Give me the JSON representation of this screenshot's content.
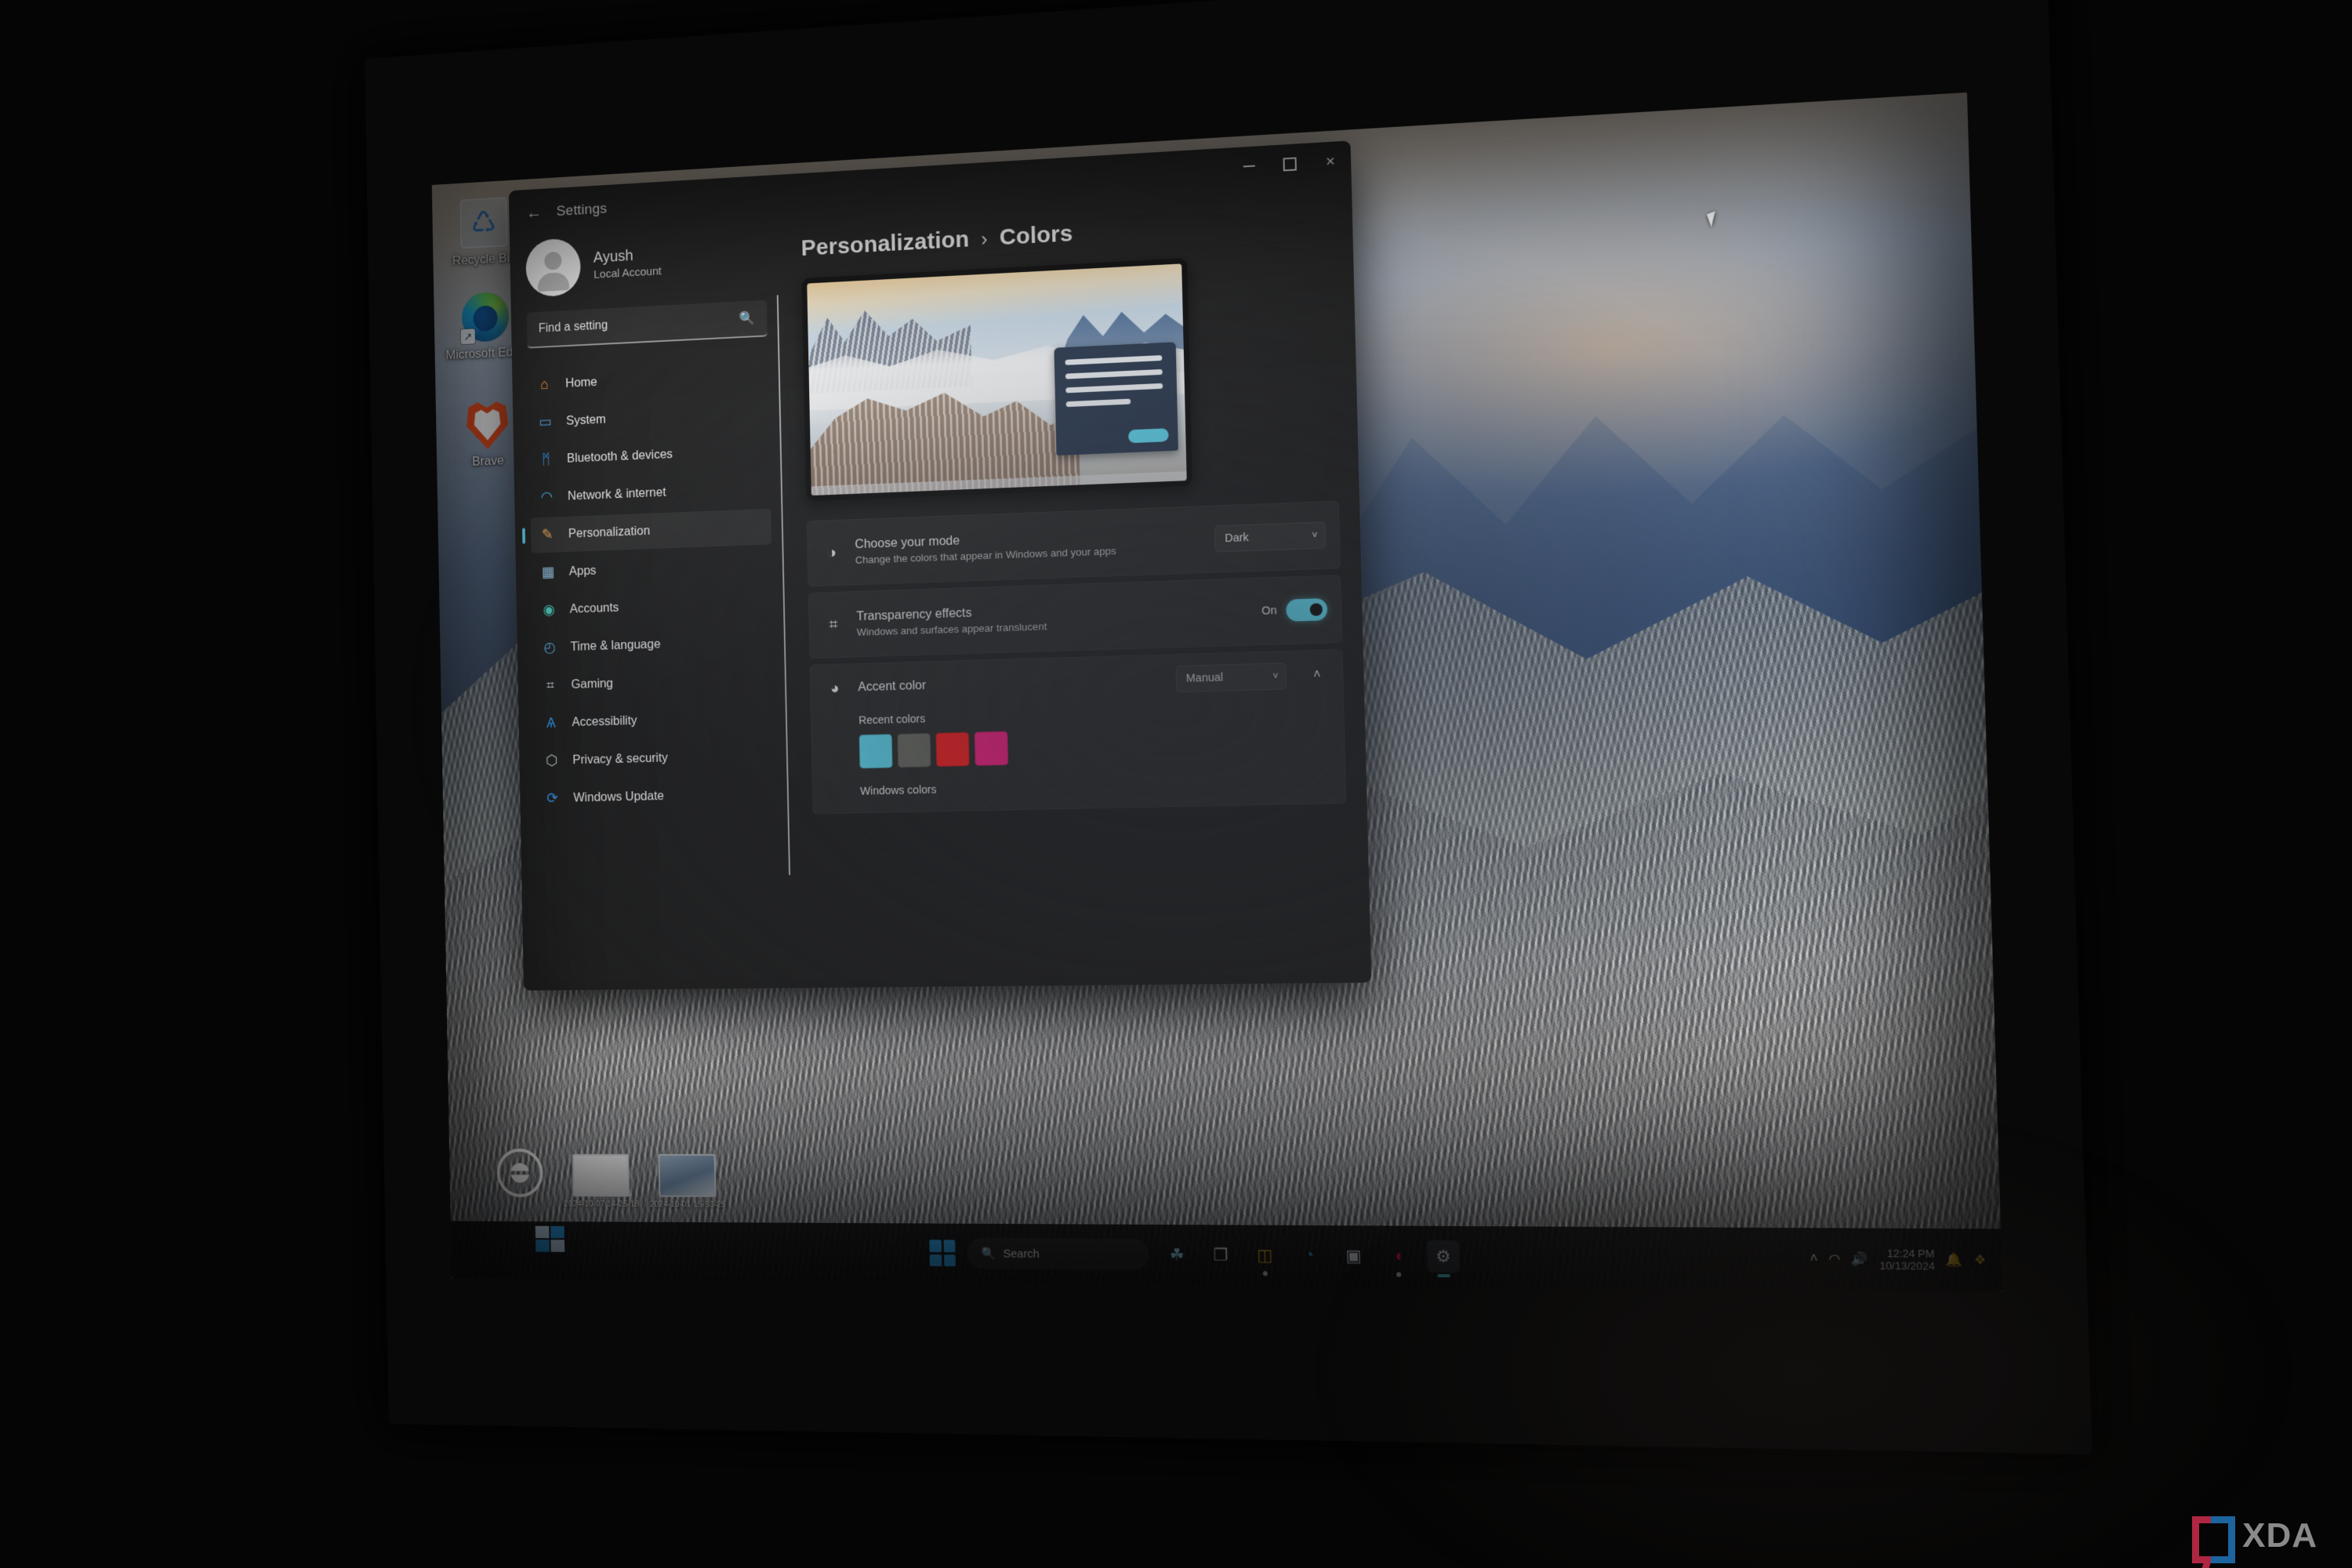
{
  "window": {
    "app_title": "Settings",
    "back_icon": "back-arrow-icon",
    "controls": {
      "minimize": "–",
      "maximize": "□",
      "close": "✕"
    }
  },
  "account": {
    "name": "Ayush",
    "type": "Local Account",
    "avatar_icon": "person-avatar-icon"
  },
  "search": {
    "placeholder": "Find a setting",
    "icon": "search-icon"
  },
  "sidebar": {
    "items": [
      {
        "label": "Home",
        "icon": "home-icon",
        "glyph": "⌂",
        "active": false
      },
      {
        "label": "System",
        "icon": "system-monitor-icon",
        "glyph": "▭",
        "active": false
      },
      {
        "label": "Bluetooth & devices",
        "icon": "bluetooth-icon",
        "glyph": "ᛗ",
        "active": false
      },
      {
        "label": "Network & internet",
        "icon": "wifi-icon",
        "glyph": "◠",
        "active": false
      },
      {
        "label": "Personalization",
        "icon": "paintbrush-icon",
        "glyph": "✎",
        "active": true
      },
      {
        "label": "Apps",
        "icon": "apps-grid-icon",
        "glyph": "▦",
        "active": false
      },
      {
        "label": "Accounts",
        "icon": "account-person-icon",
        "glyph": "◉",
        "active": false
      },
      {
        "label": "Time & language",
        "icon": "clock-globe-icon",
        "glyph": "◴",
        "active": false
      },
      {
        "label": "Gaming",
        "icon": "gamepad-icon",
        "glyph": "⌗",
        "active": false
      },
      {
        "label": "Accessibility",
        "icon": "accessibility-person-icon",
        "glyph": "Ѧ",
        "active": false
      },
      {
        "label": "Privacy & security",
        "icon": "shield-icon",
        "glyph": "⬡",
        "active": false
      },
      {
        "label": "Windows Update",
        "icon": "update-refresh-icon",
        "glyph": "⟳",
        "active": false
      }
    ]
  },
  "main": {
    "breadcrumb": {
      "parent": "Personalization",
      "separator": "›",
      "current": "Colors"
    },
    "preview": {
      "name": "colors-preview-thumbnail"
    },
    "settings": [
      {
        "title": "Choose your mode",
        "subtitle": "Change the colors that appear in Windows and your apps",
        "icon": "brightness-mode-icon",
        "glyph": "◑",
        "control": "dropdown",
        "value": "Dark",
        "chevron": "˅"
      },
      {
        "title": "Transparency effects",
        "subtitle": "Windows and surfaces appear translucent",
        "icon": "transparency-icon",
        "glyph": "⌗",
        "control": "toggle",
        "value": "On"
      }
    ],
    "accent": {
      "title": "Accent color",
      "icon": "palette-icon",
      "glyph": "◕",
      "mode_value": "Manual",
      "mode_chevron": "˅",
      "expander_chevron": "˄",
      "recent_colors_label": "Recent colors",
      "recent_colors": [
        "#5FD9F0",
        "#6B6B63",
        "#FC1E20",
        "#FF1E86"
      ],
      "windows_colors_label": "Windows colors"
    }
  },
  "desktop": {
    "icons": [
      {
        "label": "Recycle Bin",
        "icon": "recycle-bin-icon"
      },
      {
        "label": "Microsoft Edge",
        "icon": "microsoft-edge-icon"
      },
      {
        "label": "Brave",
        "icon": "brave-browser-icon"
      }
    ],
    "files": [
      {
        "name": "2024-10-07 14-25-18",
        "icon": "video-thumbnail-icon"
      },
      {
        "name": "2024-10-01 15-53-25",
        "icon": "image-thumbnail-icon"
      }
    ],
    "logo_icon": "circle-slash-logo-icon"
  },
  "taskbar": {
    "start_icon": "windows-start-icon",
    "search_placeholder": "Search",
    "search_icon": "search-icon",
    "items": [
      {
        "icon": "widgets-icon",
        "glyph": "⚘",
        "active": false,
        "running": false
      },
      {
        "icon": "task-view-icon",
        "glyph": "❐",
        "active": false,
        "running": false
      },
      {
        "icon": "file-explorer-icon",
        "glyph": "📁",
        "active": false,
        "running": true
      },
      {
        "icon": "microsoft-edge-icon",
        "glyph": "◔",
        "active": false,
        "running": false
      },
      {
        "icon": "microsoft-store-icon",
        "glyph": "▣",
        "active": false,
        "running": false
      },
      {
        "icon": "office-lens-icon",
        "glyph": "◖",
        "active": false,
        "running": true
      },
      {
        "icon": "settings-gear-icon",
        "glyph": "⚙",
        "active": true,
        "running": true
      }
    ],
    "tray": {
      "chevron_icon": "show-hidden-icons-chevron",
      "chevron_glyph": "˄",
      "network_icon": "wifi-icon",
      "network_glyph": "◠",
      "volume_icon": "speaker-volume-icon",
      "volume_glyph": "🔊",
      "time": "12:24 PM",
      "date": "10/13/2024",
      "notification_icon": "notification-bell-icon",
      "notification_glyph": "🔔",
      "extra_icon": "colorful-app-tray-icon"
    }
  },
  "watermark": {
    "text": "XDA",
    "logo_icon": "xda-bracket-logo-icon"
  }
}
